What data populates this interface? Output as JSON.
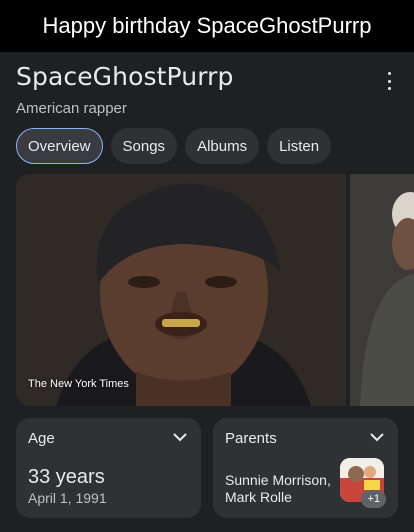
{
  "banner": {
    "text": "Happy birthday SpaceGhostPurrp"
  },
  "entity": {
    "name": "SpaceGhostPurrp",
    "description": "American rapper",
    "more_icon": "more-vert-icon"
  },
  "tabs": [
    {
      "label": "Overview",
      "active": true
    },
    {
      "label": "Songs",
      "active": false
    },
    {
      "label": "Albums",
      "active": false
    },
    {
      "label": "Listen",
      "active": false
    }
  ],
  "media": {
    "credit": "The New York Times"
  },
  "cards": {
    "age": {
      "label": "Age",
      "value": "33 years",
      "detail": "April 1, 1991",
      "icon": "chevron-down-icon"
    },
    "parents": {
      "label": "Parents",
      "names": [
        "Sunnie Morrison,",
        "Mark Rolle"
      ],
      "more_count": "+1",
      "icon": "chevron-down-icon"
    }
  },
  "colors": {
    "accent": "#8ab4f8",
    "background": "#1f2023",
    "surface": "#303134"
  }
}
